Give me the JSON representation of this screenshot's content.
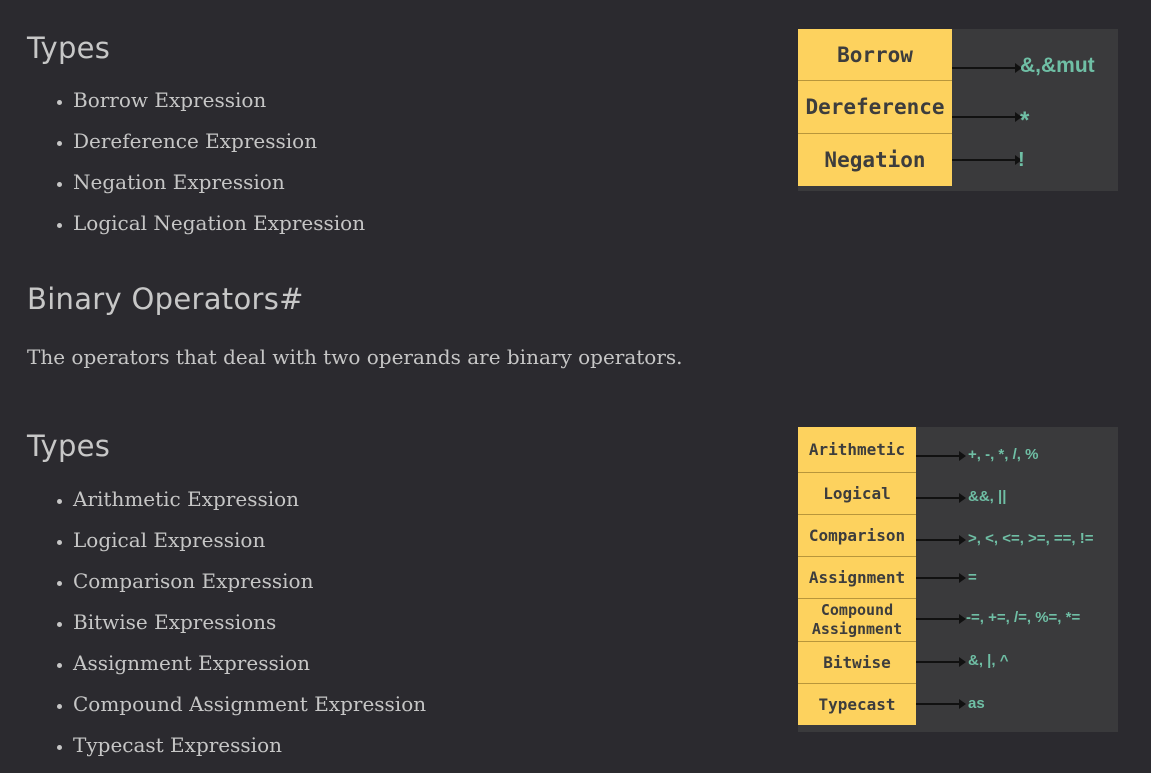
{
  "unary": {
    "heading": "Types",
    "items": [
      "Borrow Expression",
      "Dereference Expression",
      "Negation Expression",
      "Logical Negation Expression"
    ],
    "diagram": {
      "rows": [
        {
          "label": "Borrow",
          "op": "&,&mut"
        },
        {
          "label": "Dereference",
          "op": "*"
        },
        {
          "label": "Negation",
          "op": "!"
        }
      ]
    }
  },
  "binary": {
    "heading": "Binary Operators#",
    "description": "The operators that deal with two operands are binary operators.",
    "types_heading": "Types",
    "items": [
      "Arithmetic Expression",
      "Logical Expression",
      "Comparison Expression",
      "Bitwise Expressions",
      "Assignment Expression",
      "Compound Assignment Expression",
      "Typecast Expression"
    ],
    "diagram": {
      "rows": [
        {
          "label": "Arithmetic",
          "op": "+, -, *, /, %"
        },
        {
          "label": "Logical",
          "op": "&&, ||"
        },
        {
          "label": "Comparison",
          "op": ">, <, <=, >=, ==, !="
        },
        {
          "label": "Assignment",
          "op": "="
        },
        {
          "label": "Compound Assignment",
          "op": "-=, +=, /=, %=, *="
        },
        {
          "label": "Bitwise",
          "op": "&, |, ^"
        },
        {
          "label": "Typecast",
          "op": "as"
        }
      ]
    }
  },
  "colors": {
    "background": "#2b2a2f",
    "diagram_label_fill": "#fdd25e",
    "operator_text": "#6fbfa5"
  }
}
